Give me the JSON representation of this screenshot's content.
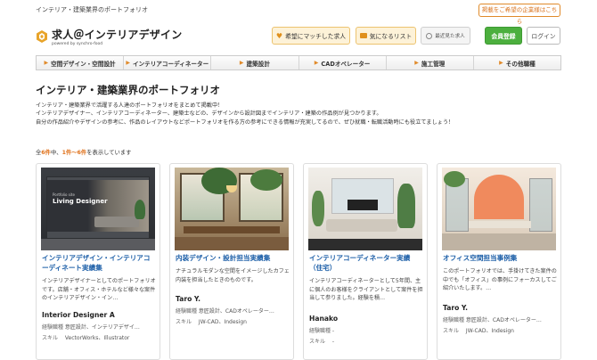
{
  "topbar": {
    "tagline": "インテリア・建築業界のポートフォリオ",
    "post_button": "掲載をご希望の企業様はこちら"
  },
  "header": {
    "logo_name": "求人＠インテリアデザイン",
    "logo_sub": "powered by synchro-food",
    "match_button": "希望にマッチした求人",
    "favorite_button": "気になるリスト",
    "recent_button": "最近見た求人",
    "register_button": "会員登録",
    "login_button": "ログイン"
  },
  "nav": {
    "items": [
      {
        "label": "空間デザイン・空間設計"
      },
      {
        "label": "インテリアコーディネーター"
      },
      {
        "label": "建築設計"
      },
      {
        "label": "CADオペレーター"
      },
      {
        "label": "施工管理"
      },
      {
        "label": "その他職種"
      }
    ]
  },
  "main": {
    "title": "インテリア・建築業界のポートフォリオ",
    "intro_lines": [
      "インテリア・建築業界で活躍する人達のポートフォリオをまとめて掲載中！",
      "インテリアデザイナー、インテリアコーディネーター、建築士などの、デザインから設計図までインテリア・建築の作品例が見つかります。",
      "自分の作品紹介やデザインの参考に、作品のレイアウトなどポートフォリオを作る方の参考にできる情報が充実してるので、ぜひ就職・転職活動時にも役立てましょう！"
    ],
    "count": {
      "prefix": "全",
      "total": "6件",
      "mid": "中、",
      "range": "1件〜6件",
      "suffix": "を表示しています"
    }
  },
  "labels": {
    "experience": "経験職種",
    "skills": "スキル"
  },
  "cards": [
    {
      "thumb_heading_small": "Portfolio site",
      "thumb_heading": "Living Designer",
      "title": "インテリアデザイン・インテリアコーディネート実績集",
      "desc": "インテリアデザイナーとしてのポートフォリオです。店舗・オフィス・ホテルなど様々な案件のインテリアデザイン・イン…",
      "author": "Interior Designer A",
      "experience": "意匠設計、インテリアデザイ…",
      "skills": "VectorWorks、Illustrator"
    },
    {
      "title": "内装デザイン・設計担当実績集",
      "desc": "ナチュラルモダンな空間をイメージしたカフェ内装を担当したときのものです。",
      "author": "Taro Y.",
      "experience": "意匠設計、CADオペレーター…",
      "skills": "JW-CAD、Indesign"
    },
    {
      "title": "インテリアコーディネーター実績（住宅）",
      "desc": "インテリアコーディネーターとして5年間、主に個人のお客様をクライアントとして案件を担当して参りました。経験を積…",
      "author": "Hanako",
      "experience": "-",
      "skills": "-"
    },
    {
      "title": "オフィス空間担当事例集",
      "desc": "このポートフォリオでは、手掛けてきた案件の中でも「オフィス」の事例にフォーカスしてご紹介いたします。…",
      "author": "Taro Y.",
      "experience": "意匠設計、CADオペレーター…",
      "skills": "JW-CAD、Indesign"
    }
  ]
}
